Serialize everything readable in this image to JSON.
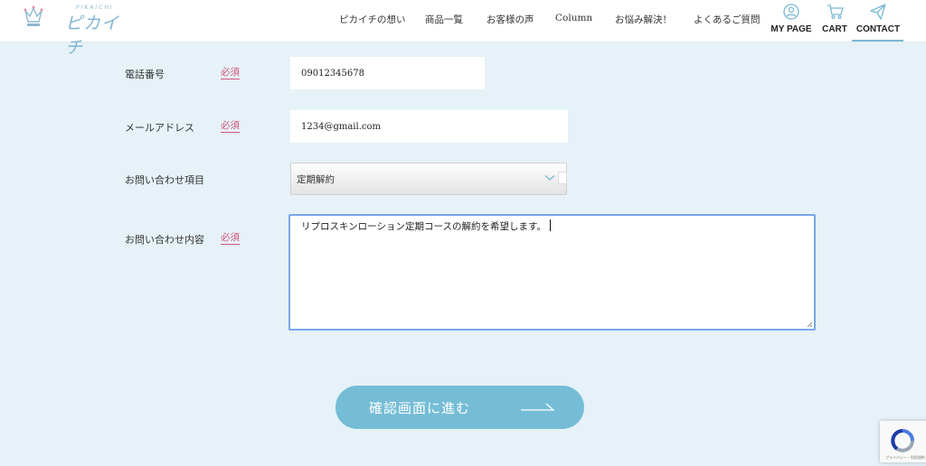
{
  "header": {
    "logo": {
      "sub": "PIKAICHI",
      "main": "ピカイチ"
    },
    "nav": [
      {
        "label": "ピカイチの想い"
      },
      {
        "label": "商品一覧"
      },
      {
        "label": "お客様の声"
      },
      {
        "label": "Column"
      },
      {
        "label": "お悩み解決！"
      },
      {
        "label": "よくあるご質問"
      }
    ],
    "icon_nav": {
      "mypage": {
        "label": "MY PAGE",
        "icon": "user-circle-icon"
      },
      "cart": {
        "label": "CART",
        "icon": "cart-icon"
      },
      "contact": {
        "label": "CONTACT",
        "icon": "paper-plane-icon"
      }
    }
  },
  "form": {
    "required_label": "必須",
    "phone": {
      "label": "電話番号",
      "value": "09012345678"
    },
    "email": {
      "label": "メールアドレス",
      "value": "1234@gmail.com"
    },
    "inquiry_type": {
      "label": "お問い合わせ項目",
      "value": "定期解約"
    },
    "inquiry_content": {
      "label": "お問い合わせ内容",
      "value": "リプロスキンローション定期コースの解約を希望します。"
    },
    "submit": {
      "label": "確認画面に進む"
    }
  },
  "recaptcha": {
    "text": "プライバシー・利用規約"
  },
  "colors": {
    "accent": "#75bdd6",
    "required": "#d2567c",
    "background": "#e6f2f7",
    "focus": "#7aa6e8"
  }
}
